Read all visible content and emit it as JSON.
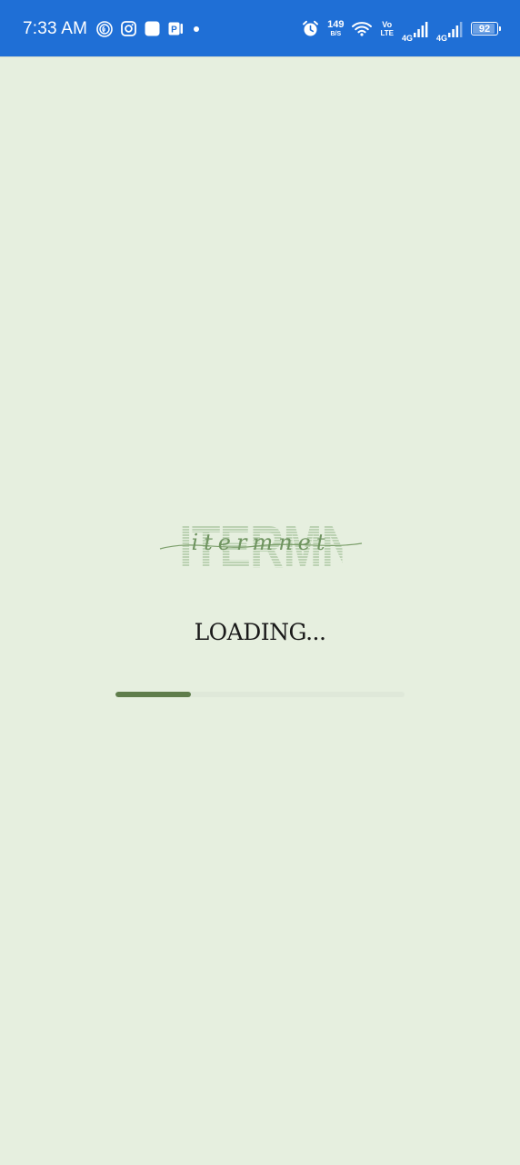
{
  "status_bar": {
    "time": "7:33 AM",
    "left_icons": [
      "fingerprint-icon",
      "instagram-icon",
      "app-square-icon",
      "parking-app-icon",
      "notification-dot-icon"
    ],
    "alarm_icon": "alarm-icon",
    "net_speed_value": "149",
    "net_speed_unit": "B/S",
    "wifi_icon": "wifi-icon",
    "volte_top": "Vo",
    "volte_bottom": "LTE",
    "sim1_label": "4G",
    "sim2_label": "4G",
    "battery_percent": "92",
    "battery_level": 0.92,
    "background_color": "#1f6fd6"
  },
  "splash": {
    "logo_text": "ITERMNET",
    "logo_script_text": "itermnet",
    "loading_label": "LOADING...",
    "progress": 0.26,
    "background_color": "#e6efdf",
    "accent_color": "#5f7d4b",
    "logo_color": "#bcd2b3"
  }
}
